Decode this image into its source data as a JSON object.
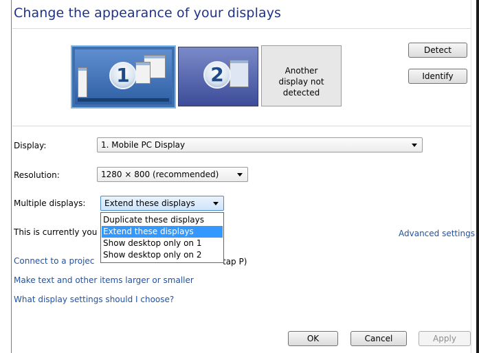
{
  "page": {
    "title": "Change the appearance of your displays"
  },
  "monitors": [
    {
      "number": "1",
      "selected": true
    },
    {
      "number": "2",
      "selected": false
    },
    {
      "text": "Another display not detected"
    }
  ],
  "buttons": {
    "detect": "Detect",
    "identify": "Identify",
    "ok": "OK",
    "cancel": "Cancel",
    "apply": "Apply"
  },
  "settings": {
    "display": {
      "label": "Display:",
      "value": "1. Mobile PC Display"
    },
    "resolution": {
      "label": "Resolution:",
      "value": "1280 × 800 (recommended)"
    },
    "multiple": {
      "label": "Multiple displays:",
      "value": "Extend these displays",
      "options": [
        "Duplicate these displays",
        "Extend these displays",
        "Show desktop only on 1",
        "Show desktop only on 2"
      ],
      "selected_index": 1
    }
  },
  "status": {
    "current_text": "This is currently you",
    "advanced_link": "Advanced settings"
  },
  "links": {
    "projector_prefix": "Connect to a projec",
    "projector_suffix": "tap P)",
    "text_size": "Make text and other items larger or smaller",
    "help": "What display settings should I choose?"
  },
  "colors": {
    "title": "#1e3287",
    "link": "#1e52a8",
    "highlight": "#3399ff"
  }
}
